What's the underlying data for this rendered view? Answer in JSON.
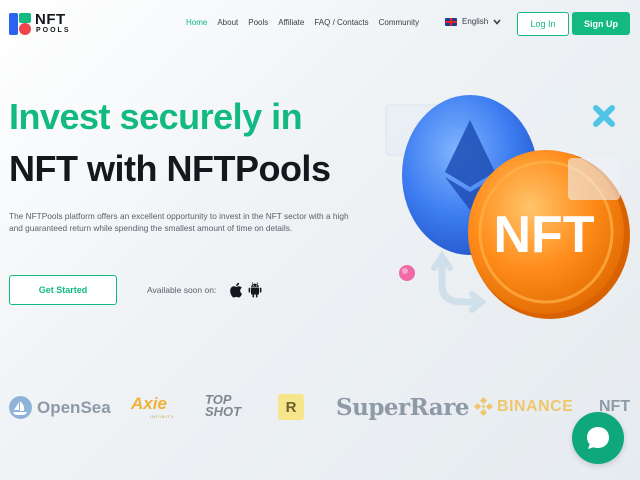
{
  "header": {
    "logo_line1": "NFT",
    "logo_line2": "POOLS",
    "nav": [
      "Home",
      "About",
      "Pools",
      "Affiliate",
      "FAQ / Contacts",
      "Community"
    ],
    "language": "English",
    "login_label": "Log In",
    "signup_label": "Sign Up"
  },
  "hero": {
    "title_line1": "Invest securely in",
    "title_line2": "NFT with NFTPools",
    "description": "The NFTPools platform offers an excellent opportunity to invest in the NFT sector with a high and guaranteed return while spending the smallest amount of time on details.",
    "cta_label": "Get Started",
    "available_text": "Available soon on:",
    "coin_text": "NFT"
  },
  "partners": {
    "opensea": "OpenSea",
    "axie": "Axie",
    "axie_sub": "INFINITY",
    "topshot_1": "TOP",
    "topshot_2": "SHOT",
    "rarible": "R",
    "superrare": "SuperRare",
    "binance": "BINANCE",
    "binance_nft": "NFT"
  },
  "colors": {
    "accent": "#12b981",
    "dark": "#15171c"
  },
  "icons": {
    "flag": "uk-flag-icon",
    "chevron": "chevron-down-icon",
    "apple": "apple-icon",
    "android": "android-icon",
    "chat": "chat-icon"
  }
}
